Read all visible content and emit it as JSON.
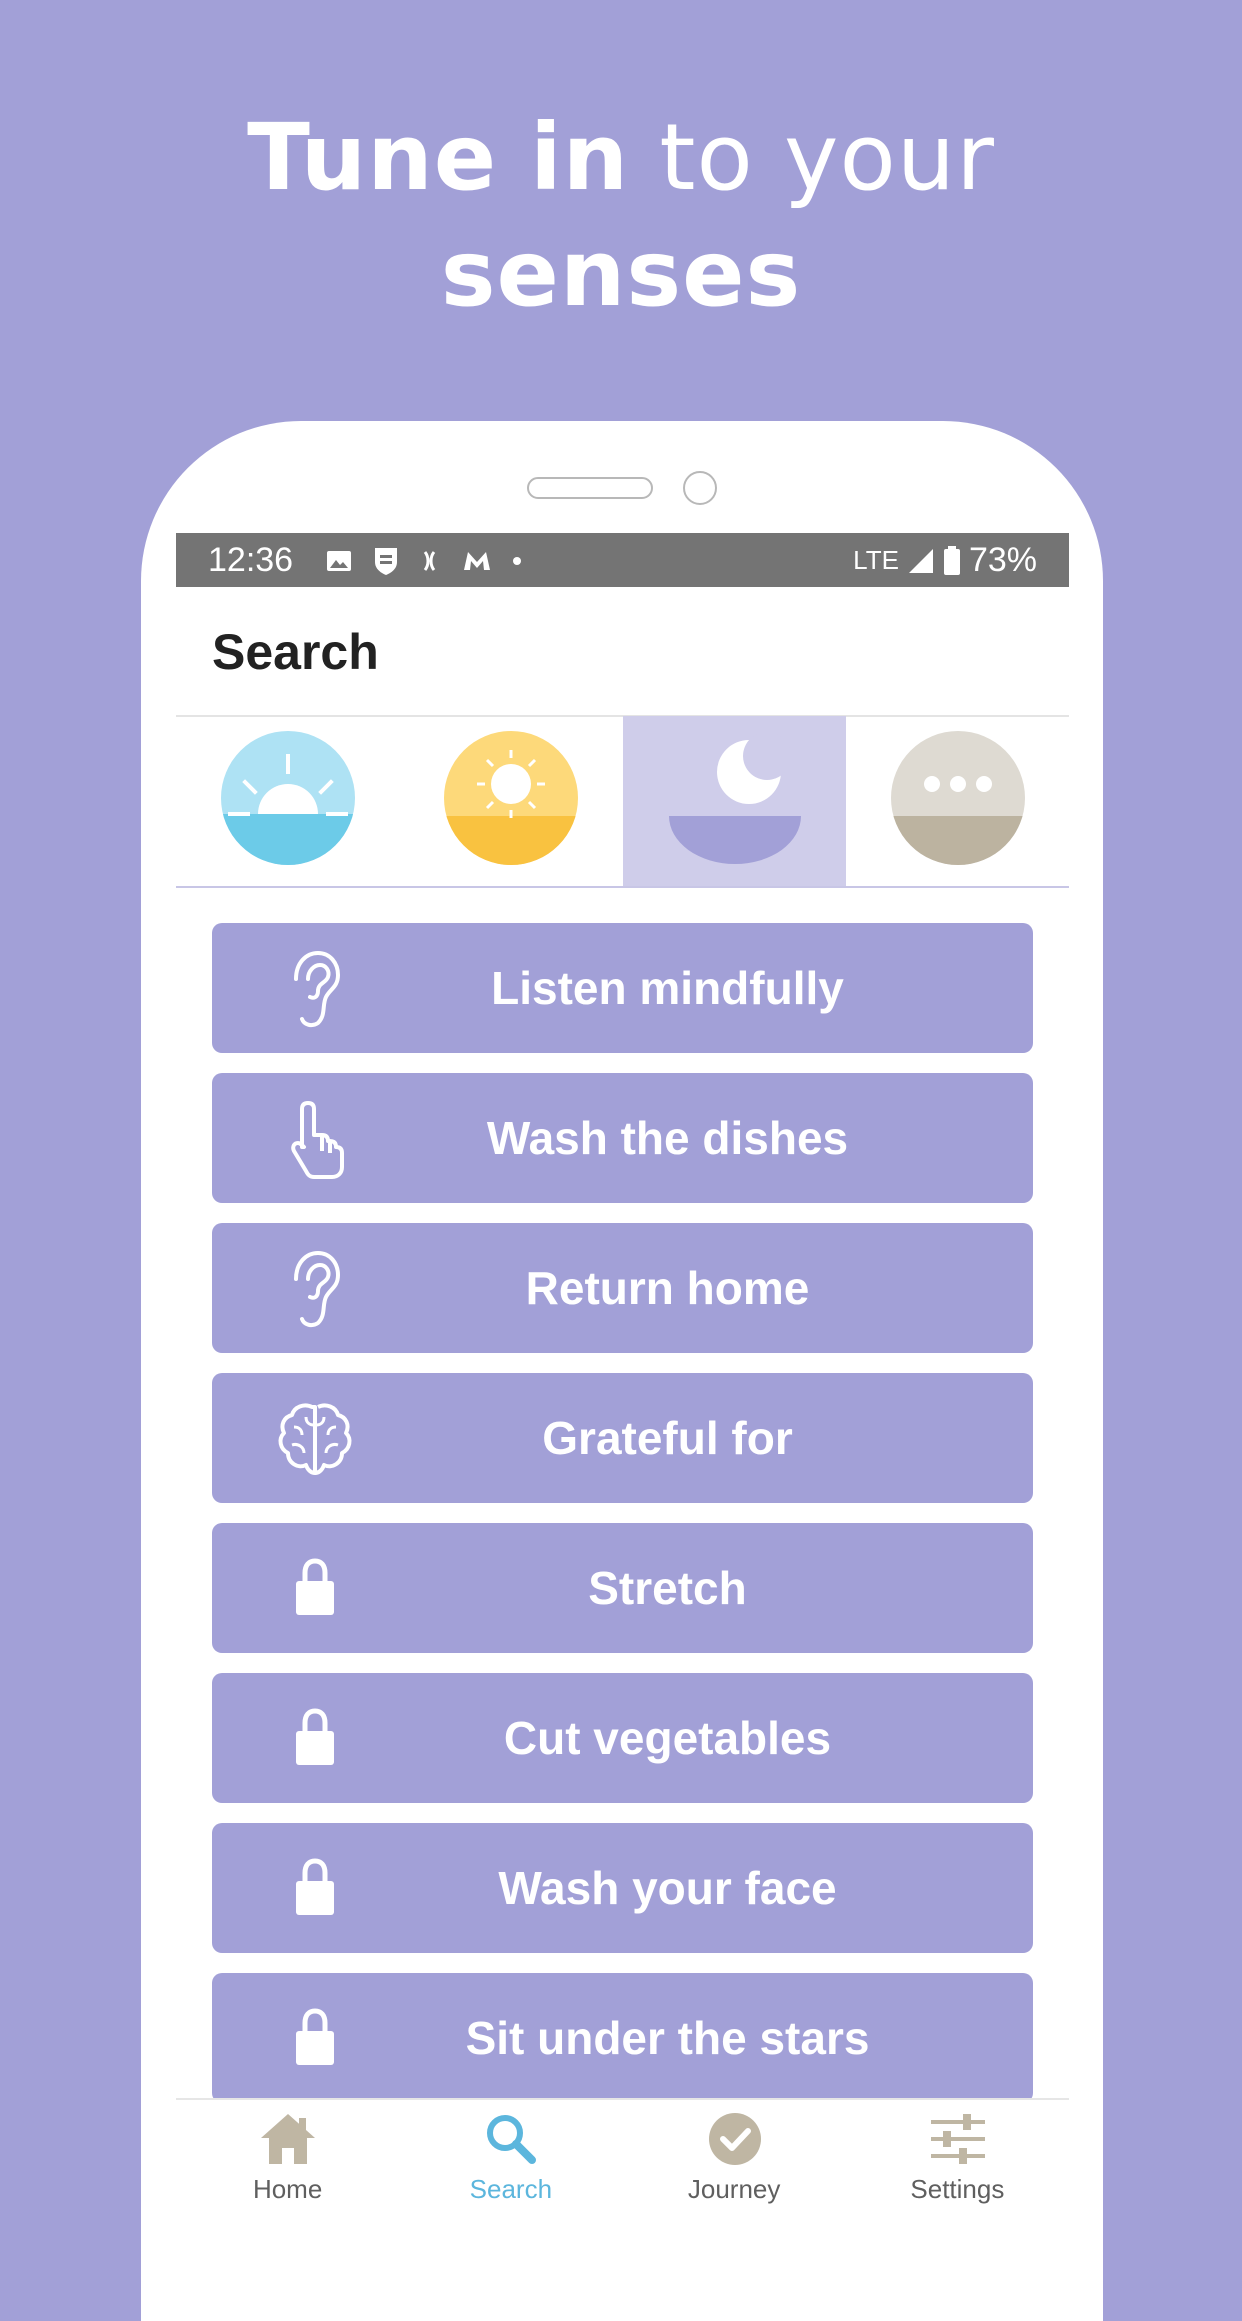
{
  "headline": {
    "line1_bold": "Tune in",
    "line1_light": " to your",
    "line2_bold": "senses"
  },
  "status_bar": {
    "time": "12:36",
    "network": "LTE",
    "battery": "73%",
    "notification_icons": [
      "image-icon",
      "shield-icon",
      "wave-icon",
      "m-logo-icon",
      "dot-icon"
    ]
  },
  "app_bar": {
    "title": "Search"
  },
  "time_tabs": [
    {
      "name": "morning-icon",
      "color": "#6ccbe8",
      "active": false
    },
    {
      "name": "midday-sun-icon",
      "color": "#f9c240",
      "active": false
    },
    {
      "name": "night-moon-icon",
      "color": "#a2a0d7",
      "active": true
    },
    {
      "name": "more-icon",
      "color": "#bcb3a0",
      "active": false
    }
  ],
  "activities": [
    {
      "label": "Listen mindfully",
      "icon": "ear-icon",
      "locked": false
    },
    {
      "label": "Wash the dishes",
      "icon": "hand-pointer-icon",
      "locked": false
    },
    {
      "label": "Return home",
      "icon": "ear-icon",
      "locked": false
    },
    {
      "label": "Grateful for",
      "icon": "brain-icon",
      "locked": false
    },
    {
      "label": "Stretch",
      "icon": "lock-icon",
      "locked": true
    },
    {
      "label": "Cut vegetables",
      "icon": "lock-icon",
      "locked": true
    },
    {
      "label": "Wash your face",
      "icon": "lock-icon",
      "locked": true
    },
    {
      "label": "Sit under the stars",
      "icon": "lock-icon",
      "locked": true
    }
  ],
  "bottom_nav": [
    {
      "label": "Home",
      "icon": "home-icon",
      "active": false
    },
    {
      "label": "Search",
      "icon": "search-icon",
      "active": true
    },
    {
      "label": "Journey",
      "icon": "check-circle-icon",
      "active": false
    },
    {
      "label": "Settings",
      "icon": "sliders-icon",
      "active": false
    }
  ],
  "colors": {
    "background": "#a2a0d7",
    "active_nav": "#5cb6dd",
    "inactive_nav_icon": "#bfb6a3",
    "status_bar": "#747474"
  }
}
